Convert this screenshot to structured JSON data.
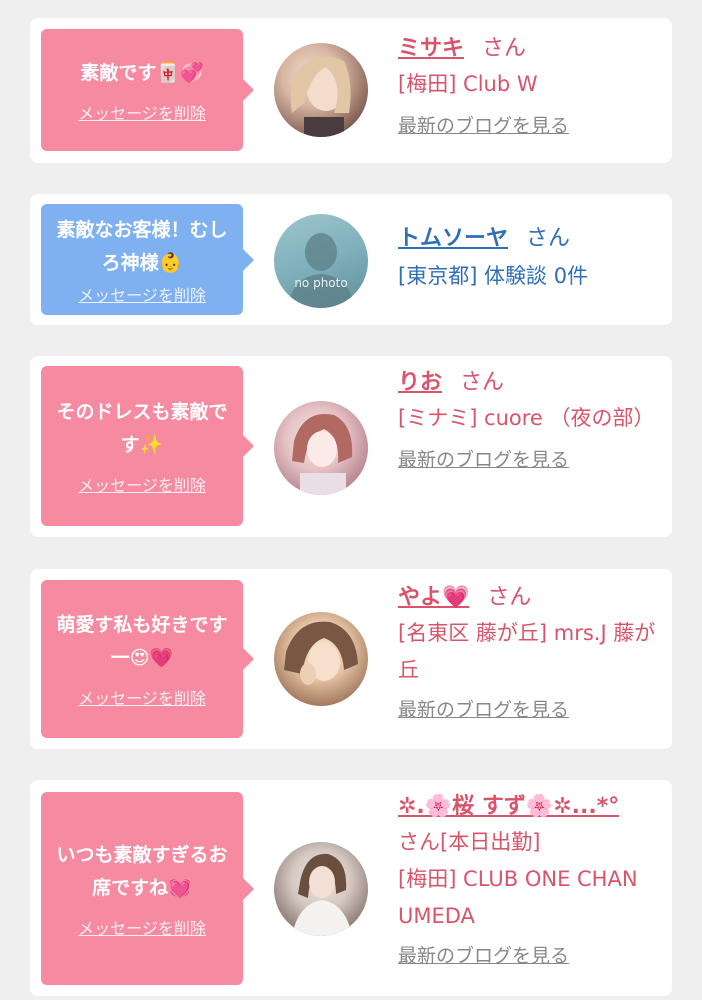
{
  "delete_label": "メッセージを削除",
  "blog_label": "最新のブログを見る",
  "san_label": "さん",
  "cards": [
    {
      "message": "素敵です🀄💞",
      "name": "ミサキ",
      "san": "さん",
      "shop": "[梅田] Club W",
      "blog": "最新のブログを見る",
      "bubble_color": "#f58aa0"
    },
    {
      "message": "素敵なお客様！むしろ神様👶",
      "name": "トムソーヤ",
      "san": "さん",
      "shop": "[東京都] 体験談 0件",
      "photo_text": "no photo",
      "bubble_color": "#7fb0f0"
    },
    {
      "message": "そのドレスも素敵です✨",
      "name": "りお",
      "san": "さん",
      "shop": "[ミナミ] cuore （夜の部）",
      "blog": "最新のブログを見る",
      "bubble_color": "#f58aa0"
    },
    {
      "message": "萌愛す私も好きです一😍💗",
      "name": "やよ💗",
      "san": "さん",
      "shop": "[名東区 藤が丘] mrs.J 藤が丘",
      "blog": "最新のブログを見る",
      "bubble_color": "#f58aa0"
    },
    {
      "message": "いつも素敵すぎるお席ですね💓",
      "name": "✲.🌸桜 すず🌸✲...*°",
      "san": "さん[本日出勤]",
      "shop": "[梅田] CLUB ONE CHAN UMEDA",
      "blog": "最新のブログを見る",
      "bubble_color": "#f58aa0"
    }
  ],
  "colors": {
    "accent_pink": "#d9546b",
    "accent_blue": "#2f6fb8",
    "bubble_pink": "#f58aa0",
    "bubble_blue": "#7fb0f0",
    "background": "#efefef"
  }
}
